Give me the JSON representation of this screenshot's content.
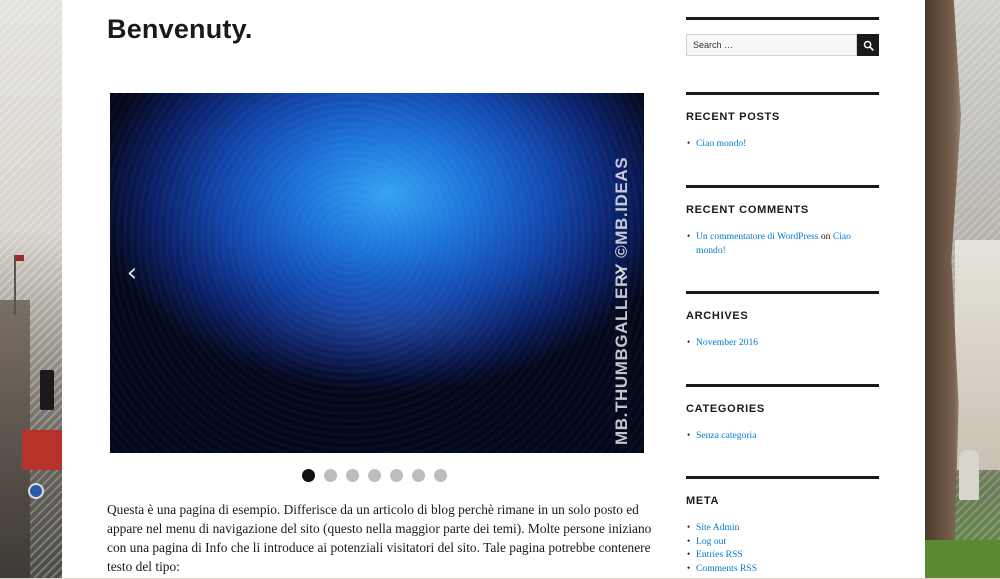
{
  "page": {
    "title": "Benvenuty.",
    "content": "Questa è una pagina di esempio. Differisce da un articolo di blog perchè rimane in un solo posto ed appare nel menu di navigazione del sito (questo nella maggior parte dei temi). Molte persone iniziano con una pagina di Info che li introduce ai potenziali visitatori del sito. Tale pagina potrebbe contenere testo del tipo:"
  },
  "slider": {
    "watermark": "MB.THUMBGALLERY ©MB.IDEAS",
    "prev_icon": "‹",
    "next_icon": "›",
    "dot_count": 7,
    "active_dot": 0
  },
  "sidebar": {
    "search": {
      "placeholder": "Search …",
      "button_icon": "search-icon"
    },
    "recent_posts": {
      "title": "RECENT POSTS",
      "items": [
        "Ciao mondo!"
      ]
    },
    "recent_comments": {
      "title": "RECENT COMMENTS",
      "author": "Un commentatore di WordPress",
      "connector": "on",
      "post": "Ciao mondo!"
    },
    "archives": {
      "title": "ARCHIVES",
      "items": [
        "November 2016"
      ]
    },
    "categories": {
      "title": "CATEGORIES",
      "items": [
        "Senza categoria"
      ]
    },
    "meta": {
      "title": "META",
      "items": [
        "Site Admin",
        "Log out",
        "Entries RSS",
        "Comments RSS"
      ]
    }
  },
  "colors": {
    "link": "#007acc",
    "text": "#1a1a1a",
    "accent_dark": "#1a1a1a"
  }
}
